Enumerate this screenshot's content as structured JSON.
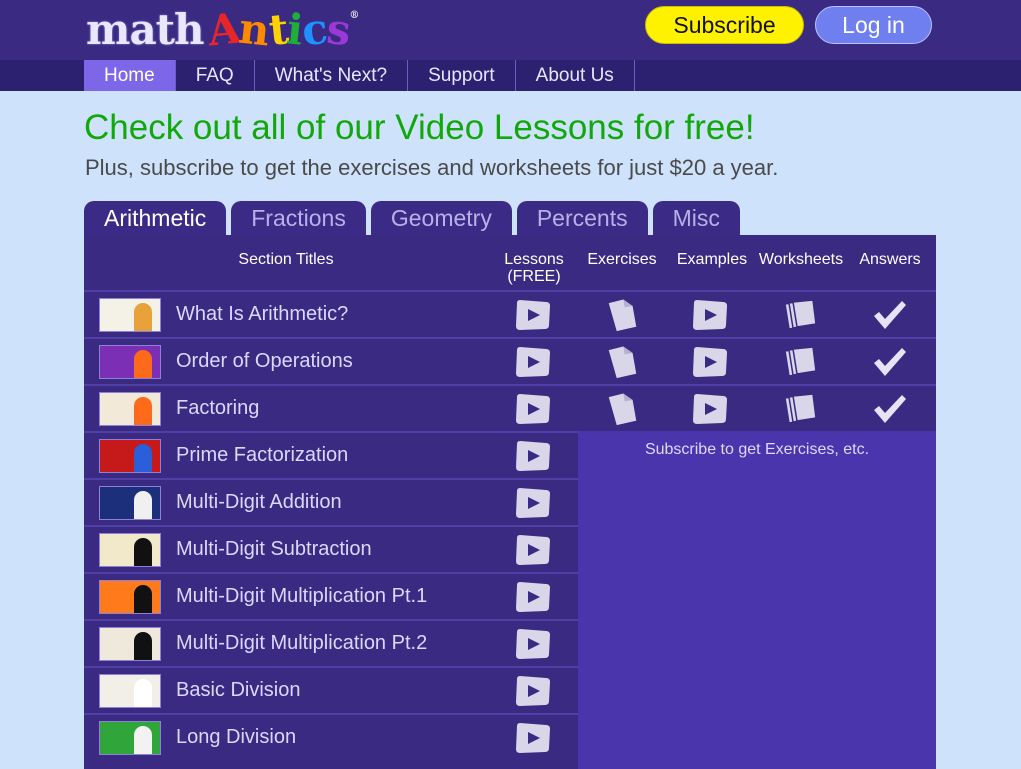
{
  "header": {
    "logo_math": "math",
    "logo_antics": "Antics",
    "subscribe_label": "Subscribe",
    "login_label": "Log in"
  },
  "nav": {
    "items": [
      "Home",
      "FAQ",
      "What's Next?",
      "Support",
      "About Us"
    ],
    "active": "Home"
  },
  "hero": {
    "headline": "Check out all of our Video Lessons for free!",
    "subline": "Plus, subscribe to get the exercises and worksheets for just $20 a year."
  },
  "tabs": {
    "items": [
      "Arithmetic",
      "Fractions",
      "Geometry",
      "Percents",
      "Misc"
    ],
    "active": "Arithmetic"
  },
  "table": {
    "headers": {
      "section_titles": "Section Titles",
      "lessons": "Lessons",
      "lessons_sub": "(FREE)",
      "exercises": "Exercises",
      "examples": "Examples",
      "worksheets": "Worksheets",
      "answers": "Answers"
    },
    "rows": [
      {
        "title": "What Is Arithmetic?",
        "full": true
      },
      {
        "title": "Order of Operations",
        "full": true
      },
      {
        "title": "Factoring",
        "full": true
      },
      {
        "title": "Prime Factorization",
        "full": false
      },
      {
        "title": "Multi-Digit Addition",
        "full": false
      },
      {
        "title": "Multi-Digit Subtraction",
        "full": false
      },
      {
        "title": "Multi-Digit Multiplication Pt.1",
        "full": false
      },
      {
        "title": "Multi-Digit Multiplication Pt.2",
        "full": false
      },
      {
        "title": "Basic Division",
        "full": false
      },
      {
        "title": "Long Division",
        "full": false
      }
    ],
    "subscribe_note": "Subscribe to get Exercises, etc."
  },
  "colors": {
    "accent_green": "#12a80c",
    "subscribe_yellow": "#fff200",
    "login_blue": "#6f7ff0",
    "panel_purple": "#3a2a82"
  }
}
